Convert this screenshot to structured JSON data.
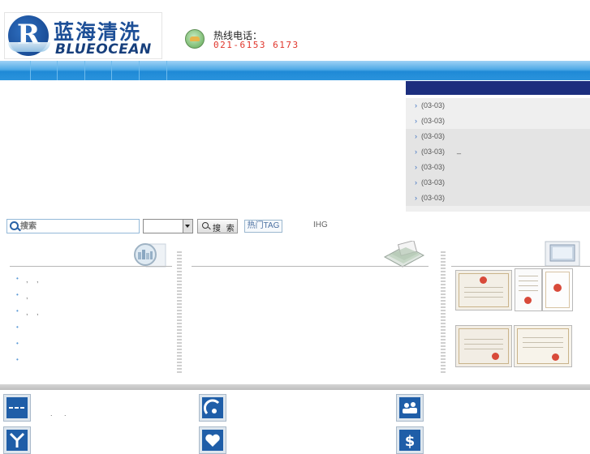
{
  "header": {
    "logo_cn": "蓝海清洗",
    "logo_en": "BLUEOCEAN",
    "logo_letter": "R",
    "hotline_label": "热线电话：",
    "hotline_number": "021-6153 6173"
  },
  "nav": {
    "item_count": 6
  },
  "news": {
    "items": [
      {
        "date": "(03-03)",
        "mark": ""
      },
      {
        "date": "(03-03)",
        "mark": ""
      },
      {
        "date": "(03-03)",
        "mark": ""
      },
      {
        "date": "(03-03)",
        "mark": "_"
      },
      {
        "date": "(03-03)",
        "mark": ""
      },
      {
        "date": "(03-03)",
        "mark": ""
      },
      {
        "date": "(03-03)",
        "mark": ""
      }
    ]
  },
  "search": {
    "placeholder": "搜索",
    "button_label": "搜 索",
    "hot_tag_label": "热门TAG",
    "hot_tag_text": "IHG"
  },
  "left_list": {
    "items": [
      {
        "bullet": "•",
        "text": ", ,"
      },
      {
        "bullet": "•",
        "text": " ,"
      },
      {
        "bullet": "•",
        "text": ", ,"
      },
      {
        "bullet": "•",
        "text": ""
      },
      {
        "bullet": "•",
        "text": ""
      },
      {
        "bullet": "•",
        "text": ""
      }
    ]
  },
  "features": {
    "row1_text": ". ."
  },
  "icons": {
    "column1": "magnifier-city-icon",
    "column2": "mailbox-icon",
    "column3": "computer-icon",
    "features": [
      "dash-icon",
      "curve-icon",
      "people-icon",
      "arrow-icon",
      "heart-icon",
      "dollar-icon"
    ]
  },
  "colors": {
    "nav_blue": "#2a93dc",
    "news_header": "#1c2e7e",
    "hotline_red": "#e0352b",
    "brand_blue": "#1d4f97"
  }
}
